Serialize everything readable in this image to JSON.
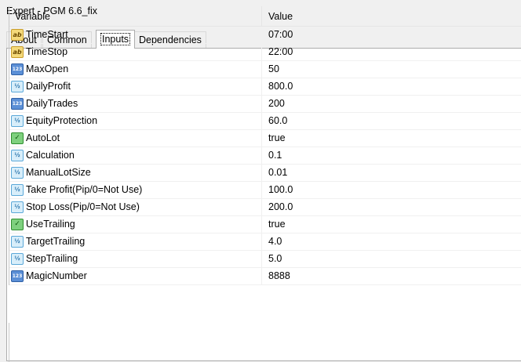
{
  "window": {
    "title": "Expert - PGM 6.6_fix"
  },
  "tabs": [
    {
      "label": "About",
      "active": false
    },
    {
      "label": "Common",
      "active": false
    },
    {
      "label": "Inputs",
      "active": true
    },
    {
      "label": "Dependencies",
      "active": false
    }
  ],
  "table": {
    "headers": {
      "variable": "Variable",
      "value": "Value"
    },
    "rows": [
      {
        "icon": "string-type-icon",
        "name": "TimeStart",
        "value": "07:00"
      },
      {
        "icon": "string-type-icon",
        "name": "TimeStop",
        "value": "22:00"
      },
      {
        "icon": "integer-type-icon",
        "name": "MaxOpen",
        "value": "50"
      },
      {
        "icon": "double-type-icon",
        "name": "DailyProfit",
        "value": "800.0"
      },
      {
        "icon": "integer-type-icon",
        "name": "DailyTrades",
        "value": "200"
      },
      {
        "icon": "double-type-icon",
        "name": "EquityProtection",
        "value": "60.0"
      },
      {
        "icon": "boolean-type-icon",
        "name": "AutoLot",
        "value": "true"
      },
      {
        "icon": "double-type-icon",
        "name": "Calculation",
        "value": "0.1"
      },
      {
        "icon": "double-type-icon",
        "name": "ManualLotSize",
        "value": "0.01"
      },
      {
        "icon": "double-type-icon",
        "name": "Take Profit(Pip/0=Not Use)",
        "value": "100.0"
      },
      {
        "icon": "double-type-icon",
        "name": "Stop Loss(Pip/0=Not Use)",
        "value": "200.0"
      },
      {
        "icon": "boolean-type-icon",
        "name": "UseTrailing",
        "value": "true"
      },
      {
        "icon": "double-type-icon",
        "name": "TargetTrailing",
        "value": "4.0"
      },
      {
        "icon": "double-type-icon",
        "name": "StepTrailing",
        "value": "5.0"
      },
      {
        "icon": "integer-type-icon",
        "name": "MagicNumber",
        "value": "8888"
      }
    ]
  },
  "icon_glyphs": {
    "string-type-icon": "ab",
    "integer-type-icon": "123",
    "double-type-icon": "½",
    "boolean-type-icon": "✓"
  },
  "colors": {
    "panel_background": "#ffffff",
    "window_background": "#f0f0f0",
    "tab_border": "#adadad"
  }
}
